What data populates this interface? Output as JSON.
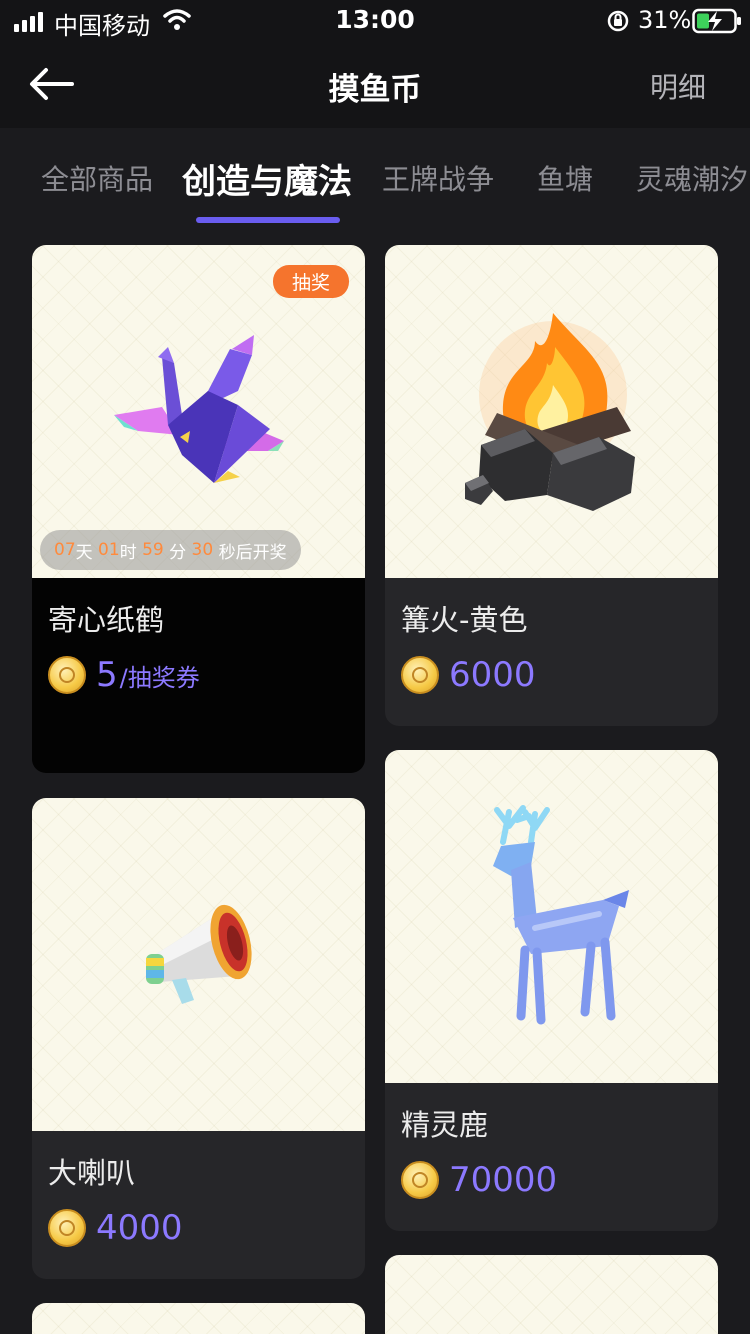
{
  "status_bar": {
    "carrier": "中国移动",
    "time": "13:00",
    "battery": "31%"
  },
  "header": {
    "title": "摸鱼币",
    "detail_label": "明细"
  },
  "tabs": [
    "全部商品",
    "创造与魔法",
    "王牌战争",
    "鱼塘",
    "灵魂潮汐"
  ],
  "active_tab": "创造与魔法",
  "products": [
    {
      "name": "寄心纸鹤",
      "badge": "抽奖",
      "price": "5",
      "price_unit": "/抽奖券",
      "countdown": {
        "days": "07",
        "days_label": "天",
        "hours": "01",
        "hours_label": "时",
        "minutes": "59",
        "minutes_label": "分",
        "seconds": "30",
        "seconds_label": "秒后开奖"
      },
      "icon": "paper-crane-icon"
    },
    {
      "name": "篝火-黄色",
      "price": "6000",
      "icon": "campfire-icon"
    },
    {
      "name": "大喇叭",
      "price": "4000",
      "icon": "megaphone-icon"
    },
    {
      "name": "精灵鹿",
      "price": "70000",
      "icon": "spirit-deer-icon"
    }
  ],
  "colors": {
    "accent": "#6a5df0",
    "price": "#8c79ff",
    "badge": "#f5742d",
    "countdown_number": "#ff8a3c"
  }
}
